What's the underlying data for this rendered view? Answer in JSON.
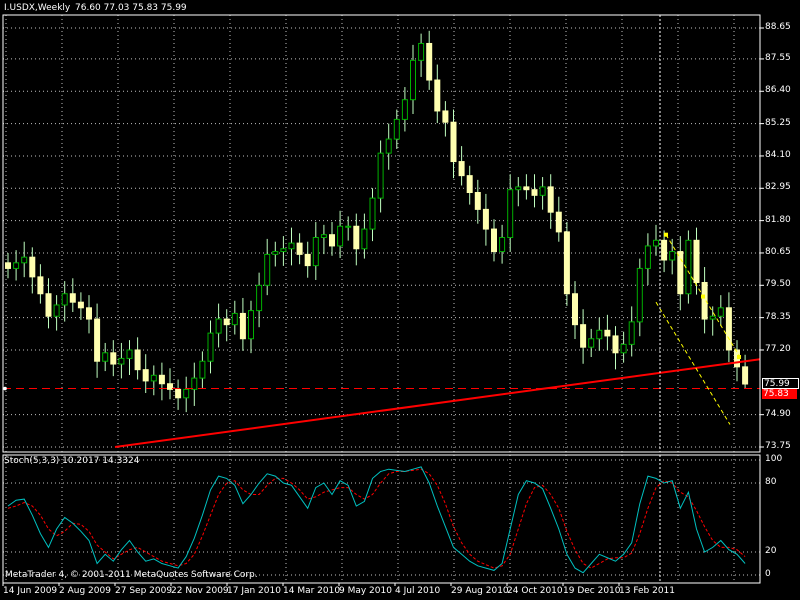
{
  "header": {
    "symbol_text": "I.USDX,Weekly",
    "ohlc_text": "76.60 77.03 75.83 75.99",
    "indicator_text": "Stoch(5,3,3) 10.2017 14.3324"
  },
  "footer": {
    "copyright": "MetaTrader 4, © 2001-2011 MetaQuotes Software Corp."
  },
  "price_tags": {
    "current": "75.99",
    "hline": "75.83"
  },
  "colors": {
    "background": "#000000",
    "grid": "#c0c0c0",
    "candle_up": "#00b000",
    "candle_down_body": "#ffffb0",
    "wick": "#c0ffc0",
    "trend_line": "#ff0000",
    "channel": "#ffff00",
    "stoch_main": "#00c0c0",
    "stoch_signal": "#ff0000"
  },
  "chart_data": [
    {
      "type": "candlestick",
      "title": "I.USDX,Weekly",
      "y_ticks": [
        "88.65",
        "87.55",
        "86.40",
        "85.25",
        "84.10",
        "82.95",
        "81.80",
        "80.65",
        "79.50",
        "78.35",
        "77.20",
        "74.90",
        "73.75"
      ],
      "x_ticks": [
        "14 Jun 2009",
        "2 Aug 2009",
        "27 Sep 2009",
        "22 Nov 2009",
        "17 Jan 2010",
        "14 Mar 2010",
        "9 May 2010",
        "4 Jul 2010",
        "29 Aug 2010",
        "24 Oct 2010",
        "19 Dec 2010",
        "13 Feb 2011"
      ],
      "ylim": [
        73.75,
        89.0
      ],
      "grid": true,
      "last_ohlc": {
        "open": 76.6,
        "high": 77.03,
        "low": 75.83,
        "close": 75.99
      },
      "close": [
        80.1,
        80.3,
        80.5,
        79.8,
        79.2,
        78.4,
        78.8,
        79.2,
        78.9,
        78.7,
        78.3,
        76.8,
        77.1,
        76.7,
        76.9,
        77.2,
        76.5,
        76.1,
        76.3,
        76.0,
        75.8,
        75.5,
        75.8,
        76.2,
        76.8,
        77.8,
        78.3,
        78.1,
        78.5,
        77.6,
        78.6,
        79.5,
        80.6,
        80.7,
        80.8,
        81.0,
        80.6,
        80.2,
        81.2,
        81.3,
        80.9,
        81.6,
        81.6,
        80.8,
        81.5,
        82.6,
        84.2,
        84.7,
        85.4,
        86.1,
        87.5,
        88.1,
        86.8,
        85.7,
        85.3,
        83.9,
        83.4,
        82.8,
        82.2,
        81.5,
        80.7,
        81.2,
        82.9,
        83.0,
        82.9,
        82.7,
        83.0,
        82.1,
        81.4,
        79.2,
        78.1,
        77.3,
        77.6,
        77.9,
        77.7,
        77.1,
        77.4,
        78.2,
        80.1,
        80.9,
        81.1,
        80.4,
        80.7,
        79.2,
        81.1,
        79.6,
        78.3,
        78.4,
        78.7,
        77.2,
        76.6,
        75.99
      ],
      "trend_line": {
        "start": {
          "date": "13 Sep 2009",
          "price": 73.75
        },
        "end": {
          "date": "6 Mar 2011",
          "price": 76.8
        }
      },
      "horizontal_line": {
        "price": 75.83
      },
      "channel": {
        "upper": [
          [
            81.3,
            "19 Dec 2010"
          ],
          [
            76.95,
            "6 Mar 2011"
          ]
        ]
      }
    },
    {
      "type": "line",
      "title": "Stoch(5,3,3) 10.2017 14.3324",
      "y_ticks": [
        "100",
        "80",
        "20",
        "0"
      ],
      "ylim": [
        0,
        100
      ],
      "series": [
        {
          "name": "Main",
          "values": [
            60,
            65,
            66,
            52,
            36,
            24,
            40,
            50,
            45,
            38,
            30,
            10,
            18,
            12,
            22,
            30,
            20,
            12,
            14,
            10,
            8,
            6,
            16,
            32,
            52,
            74,
            86,
            84,
            78,
            62,
            70,
            80,
            88,
            86,
            80,
            78,
            68,
            58,
            76,
            80,
            70,
            82,
            78,
            60,
            64,
            84,
            90,
            92,
            91,
            90,
            92,
            94,
            80,
            60,
            42,
            24,
            18,
            12,
            8,
            6,
            4,
            10,
            40,
            70,
            82,
            80,
            75,
            58,
            40,
            18,
            6,
            2,
            10,
            18,
            15,
            12,
            18,
            28,
            62,
            86,
            84,
            80,
            82,
            58,
            72,
            40,
            20,
            24,
            30,
            22,
            18,
            10
          ]
        },
        {
          "name": "Signal",
          "values": [
            58,
            60,
            63,
            60,
            52,
            40,
            34,
            38,
            45,
            44,
            38,
            26,
            20,
            14,
            18,
            22,
            24,
            20,
            16,
            12,
            10,
            8,
            10,
            18,
            34,
            52,
            70,
            80,
            82,
            74,
            70,
            70,
            78,
            84,
            84,
            80,
            74,
            66,
            68,
            72,
            74,
            76,
            76,
            70,
            66,
            70,
            80,
            88,
            90,
            90,
            91,
            92,
            88,
            78,
            62,
            42,
            28,
            18,
            12,
            9,
            6,
            8,
            18,
            40,
            62,
            76,
            78,
            70,
            58,
            38,
            22,
            10,
            6,
            10,
            14,
            15,
            15,
            19,
            36,
            58,
            76,
            82,
            80,
            72,
            68,
            56,
            42,
            30,
            24,
            24,
            22,
            16
          ]
        }
      ]
    }
  ]
}
